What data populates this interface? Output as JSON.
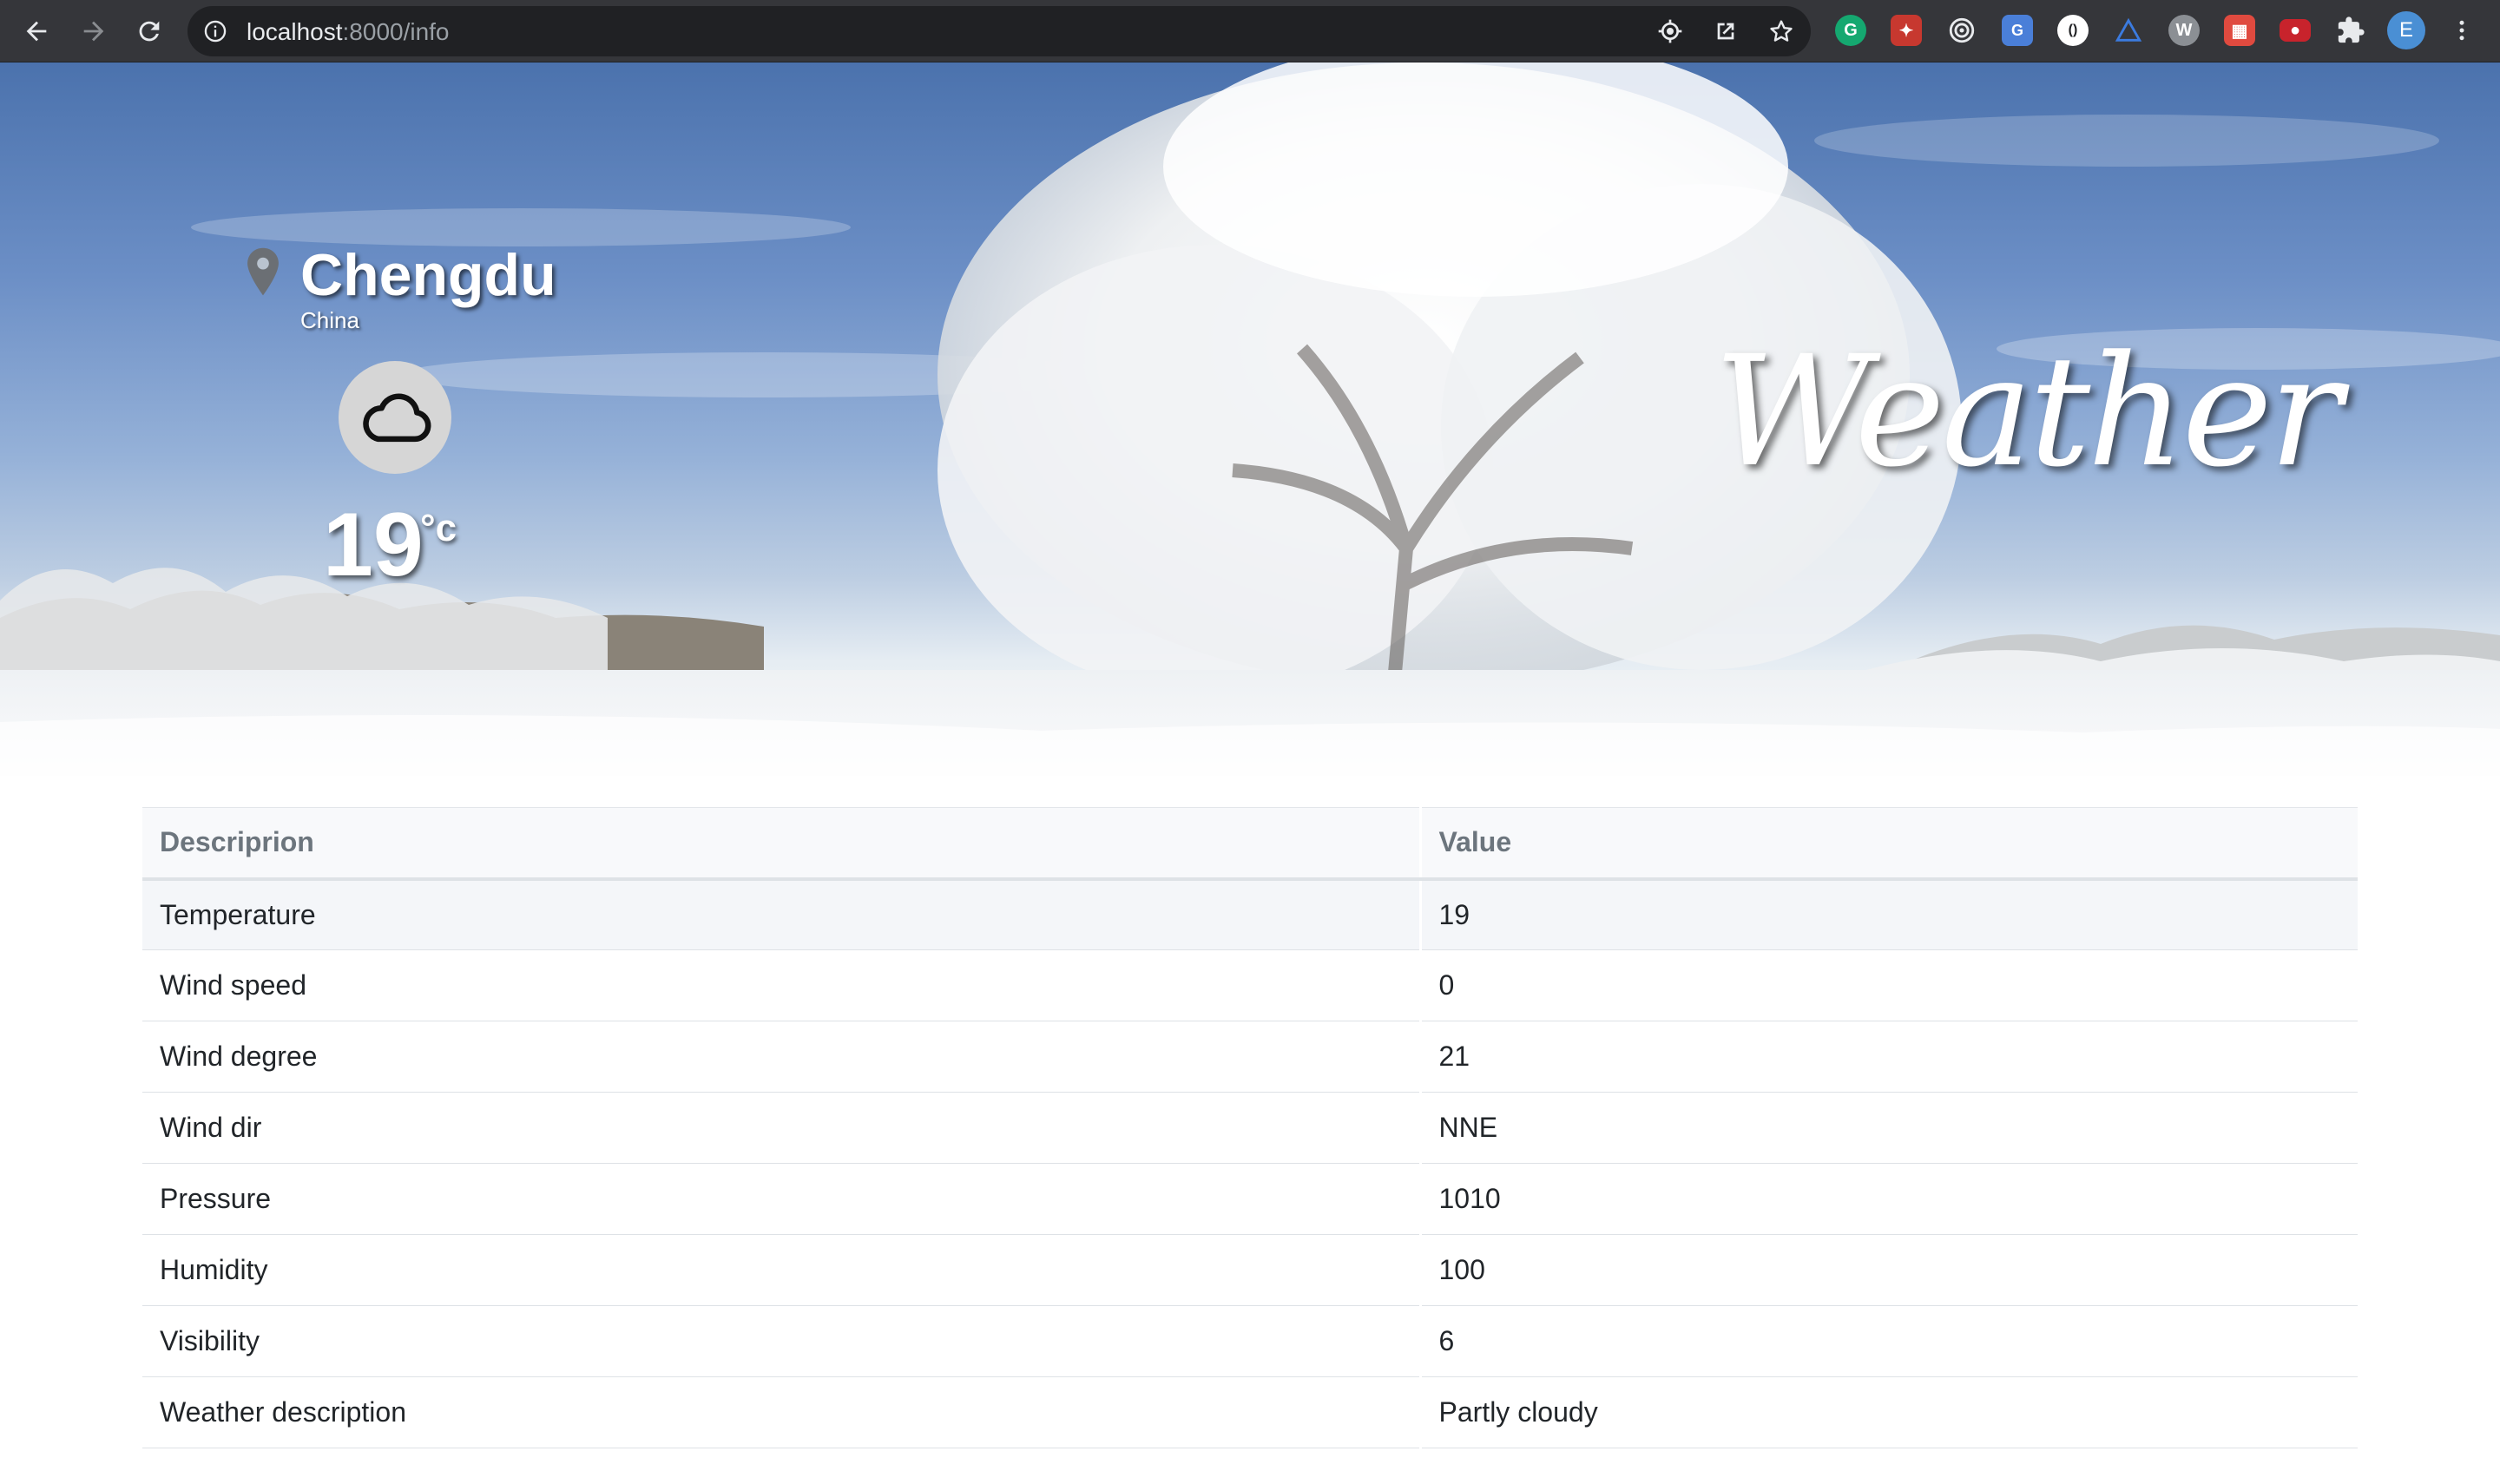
{
  "browser": {
    "url_host": "localhost",
    "url_path": ":8000/info",
    "profile_initial": "E",
    "extensions": [
      "grammarly-icon",
      "extension-red-icon",
      "target-icon",
      "translate-icon",
      "circle-extension-icon",
      "vector-icon",
      "w-extension-icon",
      "calendar-extension-icon",
      "red-extension-icon"
    ]
  },
  "weather": {
    "city": "Chengdu",
    "country": "China",
    "temperature": "19",
    "unit": "°c",
    "condition_icon": "cloud-icon",
    "brand": "Weather"
  },
  "table": {
    "headers": [
      "Descriprion",
      "Value"
    ],
    "rows": [
      {
        "label": "Temperature",
        "value": "19"
      },
      {
        "label": "Wind speed",
        "value": "0"
      },
      {
        "label": "Wind degree",
        "value": "21"
      },
      {
        "label": "Wind dir",
        "value": "NNE"
      },
      {
        "label": "Pressure",
        "value": "1010"
      },
      {
        "label": "Humidity",
        "value": "100"
      },
      {
        "label": "Visibility",
        "value": "6"
      },
      {
        "label": "Weather description",
        "value": "Partly cloudy"
      }
    ]
  }
}
